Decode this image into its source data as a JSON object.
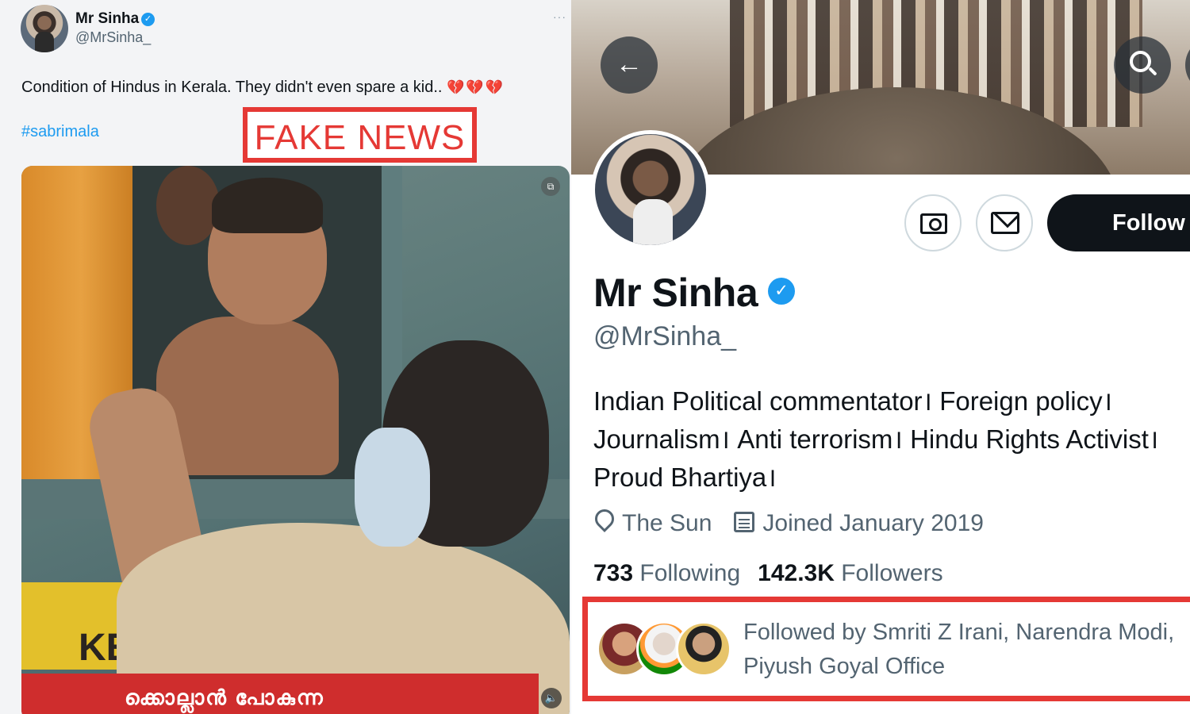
{
  "tweet": {
    "author_name": "Mr Sinha",
    "author_handle": "@MrSinha_",
    "verified_badge": "✓",
    "more_label": "···",
    "text": "Condition of Hindus in Kerala. They didn't even spare a kid..",
    "emoji": "💔💔💔",
    "hashtag": "#sabrimala",
    "media_gif_icon": "gif-icon",
    "media_mute_icon": "mute-icon",
    "media_caption_partial": "ക്കൊല്ലാൻ പോകുന്ന",
    "media_sign_text": "KE"
  },
  "overlay": {
    "fake_label": "FAKE NEWS",
    "color": "#e53935"
  },
  "profile": {
    "name": "Mr Sinha",
    "verified_badge": "✓",
    "handle": "@MrSinha_",
    "bio_lines": [
      "Indian Political commentator। Foreign policy।",
      "Journalism। Anti terrorism। Hindu Rights Activist।",
      "Proud Bhartiya।"
    ],
    "location": "The Sun",
    "joined": "Joined January 2019",
    "following_count": "733",
    "following_label": "Following",
    "followers_count": "142.3K",
    "followers_label": "Followers",
    "followed_by_line1": "Followed by Smriti Z Irani, Narendra Modi,",
    "followed_by_line2": "Piyush Goyal Office",
    "follow_button": "Follow",
    "back_icon": "←",
    "accent": "#1d9bf0",
    "follow_bg": "#0f1419"
  }
}
